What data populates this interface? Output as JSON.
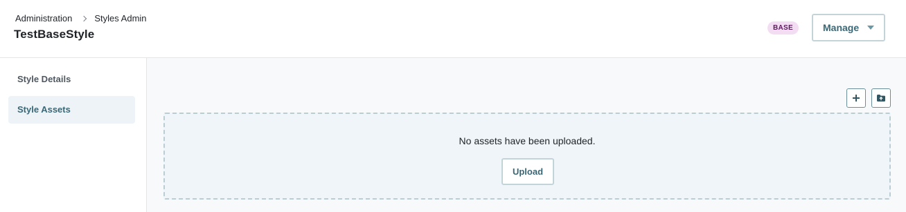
{
  "header": {
    "breadcrumb": [
      "Administration",
      "Styles Admin"
    ],
    "title": "TestBaseStyle",
    "badge": "BASE",
    "manage_label": "Manage"
  },
  "sidebar": {
    "items": [
      {
        "label": "Style Details",
        "active": false
      },
      {
        "label": "Style Assets",
        "active": true
      }
    ]
  },
  "main": {
    "toolbar_icons": [
      "plus-icon",
      "folder-upload-icon"
    ],
    "empty_message": "No assets have been uploaded.",
    "upload_label": "Upload"
  },
  "colors": {
    "accent": "#3a6776",
    "badge_bg": "#f3ddf3",
    "active_nav_bg": "#edf3f6",
    "dropzone_bg": "#eff5f8"
  }
}
